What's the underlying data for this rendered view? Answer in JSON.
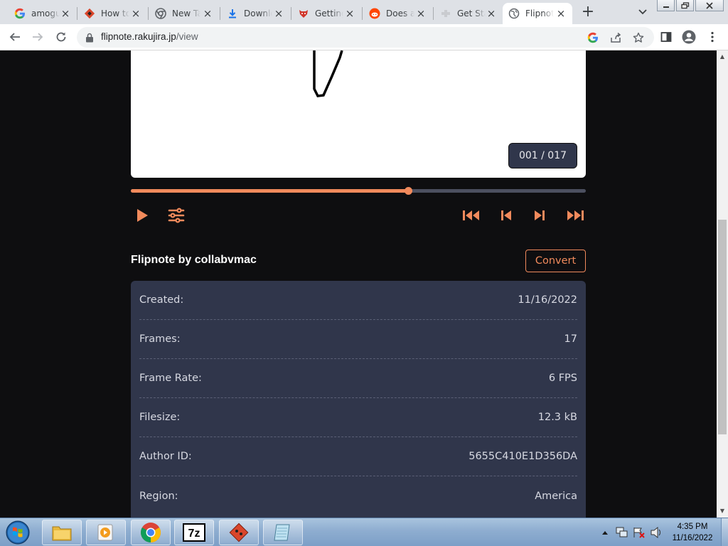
{
  "browser": {
    "tabs": [
      {
        "title": "amogus",
        "icon": "google-icon"
      },
      {
        "title": "How to",
        "icon": "red-diamond-icon"
      },
      {
        "title": "New Tab",
        "icon": "chrome-icon"
      },
      {
        "title": "Downloads",
        "icon": "download-icon"
      },
      {
        "title": "Getting",
        "icon": "red-fox-icon"
      },
      {
        "title": "Does a",
        "icon": "reddit-icon"
      },
      {
        "title": "Get Started",
        "icon": "puzzle-icon"
      },
      {
        "title": "Flipnote",
        "icon": "globe-icon",
        "active": true
      }
    ],
    "url_host": "flipnote.rakujira.jp",
    "url_path": "/view"
  },
  "player": {
    "frame_counter": "001 / 017",
    "progress": 0.61
  },
  "flipnote": {
    "title": "Flipnote by collabvmac",
    "convert_label": "Convert",
    "details": [
      {
        "label": "Created:",
        "value": "11/16/2022"
      },
      {
        "label": "Frames:",
        "value": "17"
      },
      {
        "label": "Frame Rate:",
        "value": "6 FPS"
      },
      {
        "label": "Filesize:",
        "value": "12.3 kB"
      },
      {
        "label": "Author ID:",
        "value": "5655C410E1D356DA"
      },
      {
        "label": "Region:",
        "value": "America"
      }
    ]
  },
  "taskbar": {
    "time": "4:35 PM",
    "date": "11/16/2022"
  },
  "colors": {
    "accent": "#f18a5c",
    "panel": "#30364b",
    "page_bg": "#0e0e10"
  }
}
